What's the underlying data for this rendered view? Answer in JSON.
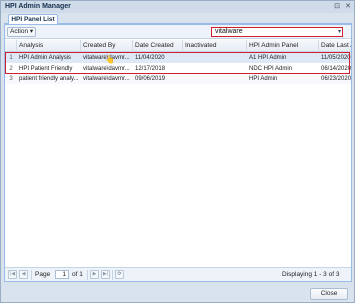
{
  "window": {
    "title": "HPI Admin Manager",
    "restore_glyph": "⊡",
    "close_glyph": "✕"
  },
  "tabs": [
    {
      "label": "HPI Panel List",
      "active": true
    }
  ],
  "toolbar": {
    "action_label": "Action ▾",
    "filter_value": "vitalware",
    "filter_arrow": "▾"
  },
  "grid": {
    "columns": [
      "",
      "Analysis",
      "Created By",
      "Date Created",
      "Inactivated",
      "HPI Admin Panel",
      "Date Last Ac"
    ],
    "rows": [
      {
        "num": "1",
        "analysis": "HPI Admin Analysis",
        "created_by": "vitalware\\davmr...",
        "date_created": "11/04/2020",
        "inactivated": "",
        "panel": "A1 HPI Admin",
        "last": "11/05/2020"
      },
      {
        "num": "2",
        "analysis": "HPI Patient Friendly",
        "created_by": "vitalware\\davmr...",
        "date_created": "12/17/2018",
        "inactivated": "",
        "panel": "NDC HPI Admin",
        "last": "06/14/2020"
      },
      {
        "num": "3",
        "analysis": "patient friendly analy...",
        "created_by": "vitalware\\davmr...",
        "date_created": "09/06/2019",
        "inactivated": "",
        "panel": "HPI Admin",
        "last": "06/23/2020"
      }
    ]
  },
  "pager": {
    "page_label": "Page",
    "current_page": "1",
    "of_label": "of 1",
    "display_text": "Displaying 1 - 3 of 3",
    "first_glyph": "|◀",
    "prev_glyph": "◀",
    "next_glyph": "▶",
    "last_glyph": "▶|",
    "refresh_glyph": "⟳"
  },
  "footer": {
    "close_label": "Close"
  },
  "colors": {
    "highlight": "#d01f2e",
    "selected_row": "#dfe8f6"
  }
}
